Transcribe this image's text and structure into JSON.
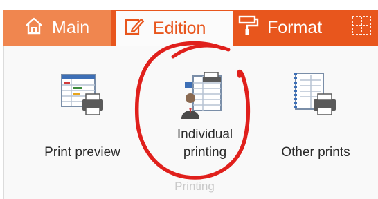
{
  "tabs": {
    "main": {
      "label": "Main",
      "icon": "home-icon"
    },
    "edition": {
      "label": "Edition",
      "icon": "edit-icon",
      "active": true
    },
    "format": {
      "label": "Format",
      "icon": "paint-roller-icon"
    },
    "extra": {
      "icon": "grid-icon"
    }
  },
  "panel": {
    "buttons": {
      "print_preview": {
        "label": "Print preview",
        "icon": "print-preview-icon"
      },
      "individual_printing": {
        "line1": "Individual",
        "line2": "printing",
        "icon": "individual-printing-icon"
      },
      "other_prints": {
        "label": "Other prints",
        "icon": "other-prints-icon"
      }
    },
    "group_label": "Printing"
  },
  "colors": {
    "ribbon": "#e8561d",
    "main_tab": "#f0864f",
    "active_tab_bg": "#fbfbfb",
    "annotation_circle": "#e0201c"
  }
}
